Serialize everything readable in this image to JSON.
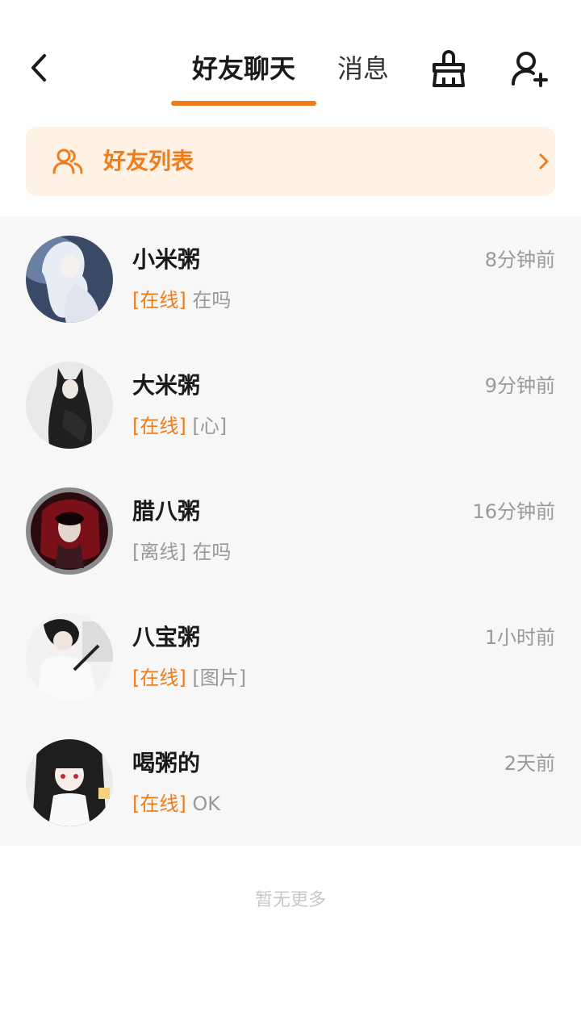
{
  "colors": {
    "accent": "#f07c1c",
    "banner_bg": "#fff1e4",
    "list_bg": "#f7f7f7",
    "text_primary": "#1a1a1a",
    "text_secondary": "#999999"
  },
  "header": {
    "back_icon": "chevron-left-icon",
    "tabs": [
      {
        "label": "好友聊天",
        "active": true
      },
      {
        "label": "消息",
        "active": false
      }
    ],
    "clean_icon": "broom-icon",
    "add_friend_icon": "add-user-icon"
  },
  "banner": {
    "icon": "friends-icon",
    "label": "好友列表",
    "chevron_icon": "chevron-right-icon"
  },
  "chats": [
    {
      "name": "小米粥",
      "time": "8分钟前",
      "status": "[在线]",
      "online": true,
      "message": "在吗"
    },
    {
      "name": "大米粥",
      "time": "9分钟前",
      "status": "[在线]",
      "online": true,
      "message": "[心]"
    },
    {
      "name": "腊八粥",
      "time": "16分钟前",
      "status": "[离线]",
      "online": false,
      "message": "在吗"
    },
    {
      "name": "八宝粥",
      "time": "1小时前",
      "status": "[在线]",
      "online": true,
      "message": "[图片]"
    },
    {
      "name": "喝粥的",
      "time": "2天前",
      "status": "[在线]",
      "online": true,
      "message": "OK"
    }
  ],
  "footer": {
    "text": "暂无更多"
  }
}
